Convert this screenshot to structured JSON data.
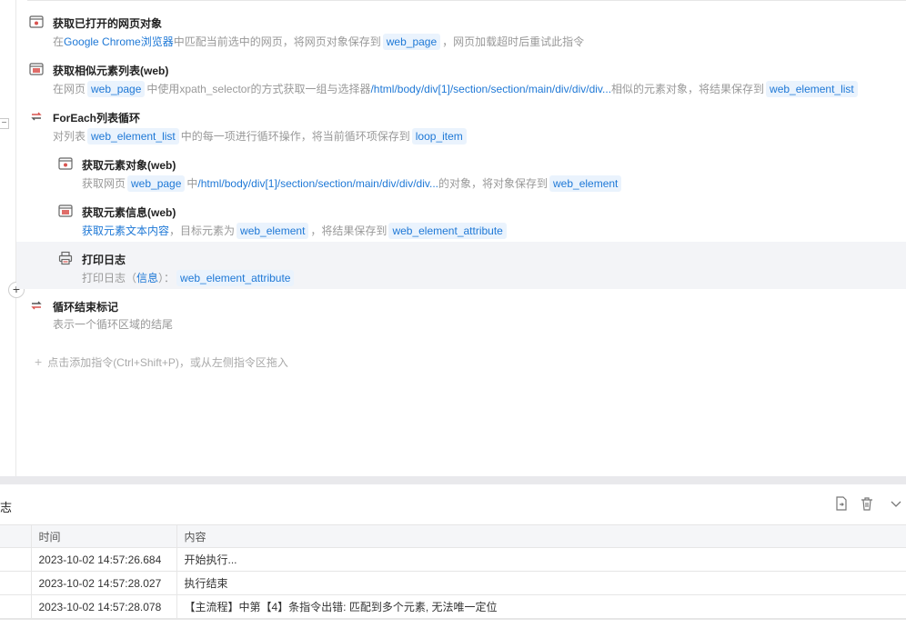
{
  "commands": [
    {
      "title": "获取已打开的网页对象",
      "icon": "browser-page-icon",
      "desc": {
        "a": "在",
        "b": "Google Chrome浏览器",
        "c": "中匹配当前选中的网页，将网页对象保存到",
        "chip": "web_page",
        "d": "，网页加载超时后重试此指令"
      }
    },
    {
      "title": "获取相似元素列表(web)",
      "icon": "web-element-list-icon",
      "desc": {
        "a": "在网页",
        "chip1": "web_page",
        "b": "中使用xpath_selector的方式获取一组与选择器",
        "c": "/html/body/div[1]/section/section/main/div/div/div...",
        "d": "相似的元素对象，将结果保存到",
        "chip2": "web_element_list"
      }
    },
    {
      "title": "ForEach列表循环",
      "icon": "loop-icon",
      "desc": {
        "a": "对列表",
        "chip1": "web_element_list",
        "b": "中的每一项进行循环操作，将当前循环项保存到",
        "chip2": "loop_item"
      }
    },
    {
      "title": "获取元素对象(web)",
      "icon": "web-element-icon",
      "desc": {
        "a": "获取网页",
        "chip1": "web_page",
        "b": "中",
        "c": "/html/body/div[1]/section/section/main/div/div/div...",
        "d": "的对象，将对象保存到",
        "chip2": "web_element"
      }
    },
    {
      "title": "获取元素信息(web)",
      "icon": "web-element-info-icon",
      "desc": {
        "a": "获取元素文本内容",
        "b": "，目标元素为",
        "chip1": "web_element",
        "c": "，将结果保存到",
        "chip2": "web_element_attribute"
      }
    },
    {
      "title": "打印日志",
      "icon": "print-log-icon",
      "desc": {
        "a": "打印日志（",
        "b": "信息",
        "c": "）：",
        "chip": "web_element_attribute"
      }
    },
    {
      "title": "循环结束标记",
      "icon": "loop-end-icon",
      "desc": {
        "a": "表示一个循环区域的结尾"
      }
    }
  ],
  "collapse_symbol": "−",
  "insert_symbol": "+",
  "add_hint": {
    "plus": "+",
    "text": "点击添加指令(Ctrl+Shift+P)，或从左侧指令区拖入"
  },
  "log": {
    "title": "志",
    "columns": [
      "时间",
      "内容"
    ],
    "rows": [
      {
        "time": "2023-10-02 14:57:26.684",
        "content": "开始执行..."
      },
      {
        "time": "2023-10-02 14:57:28.027",
        "content": "执行结束"
      },
      {
        "time": "2023-10-02 14:57:28.078",
        "content": "【主流程】中第【4】条指令出错: 匹配到多个元素, 无法唯一定位"
      }
    ]
  },
  "colors": {
    "accent": "#1e78d6",
    "chip_bg": "#eaf3fd",
    "icon_red": "#d9534f",
    "highlight_row": "#f3f4f7"
  }
}
